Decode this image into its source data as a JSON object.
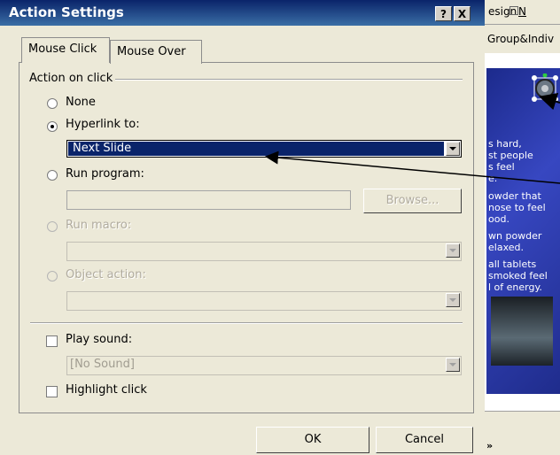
{
  "dialog": {
    "title": "Action Settings",
    "help_symbol": "?",
    "close_symbol": "X",
    "tabs": [
      {
        "label": "Mouse Click",
        "active": true
      },
      {
        "label": "Mouse Over",
        "active": false
      }
    ],
    "section_action": "Action on click",
    "options": {
      "none": "None",
      "hyperlink": "Hyperlink to:",
      "run_program": "Run program:",
      "run_macro": "Run macro:",
      "object_action": "Object action:"
    },
    "selected_option": "hyperlink",
    "hyperlink_value": "Next Slide",
    "browse_label": "Browse...",
    "play_sound_label": "Play sound:",
    "sound_value": "[No Sound]",
    "highlight_click_label": "Highlight click",
    "ok_label": "OK",
    "cancel_label": "Cancel"
  },
  "background_window": {
    "menu_design": "esign",
    "menu_new": "N",
    "tab_text": "Group&Indiv",
    "slide_lines": [
      "s hard,",
      "st people",
      "s feel",
      "e.",
      "owder that",
      "nose to feel",
      "ood.",
      "wn powder",
      "elaxed.",
      "all tablets",
      "smoked feel",
      "l of energy."
    ],
    "status_text": "»"
  },
  "colors": {
    "titlebar": "#0a246a",
    "selection": "#0a246a",
    "dialog_face": "#ece9d8",
    "slide_bg": "#2b3aa8"
  }
}
